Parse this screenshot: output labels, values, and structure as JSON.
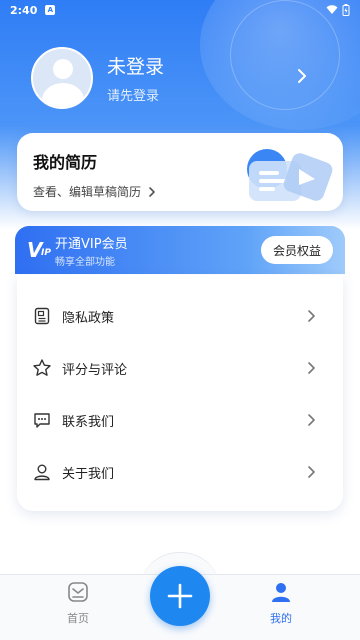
{
  "status_bar": {
    "time": "2:40",
    "notification_badge": "A"
  },
  "profile": {
    "name": "未登录",
    "hint": "请先登录"
  },
  "resume": {
    "title": "我的简历",
    "subtitle": "查看、编辑草稿简历"
  },
  "vip": {
    "logo_big": "V",
    "logo_small": "IP",
    "title": "开通VIP会员",
    "subtitle": "畅享全部功能",
    "button": "会员权益"
  },
  "menu": [
    {
      "label": "隐私政策",
      "icon": "document-icon"
    },
    {
      "label": "评分与评论",
      "icon": "star-icon"
    },
    {
      "label": "联系我们",
      "icon": "chat-icon"
    },
    {
      "label": "关于我们",
      "icon": "user-icon"
    }
  ],
  "tabs": {
    "home": "首页",
    "me": "我的"
  },
  "colors": {
    "primary": "#2f6ff2",
    "fab": "#1e88f0",
    "inactive": "#888888"
  }
}
